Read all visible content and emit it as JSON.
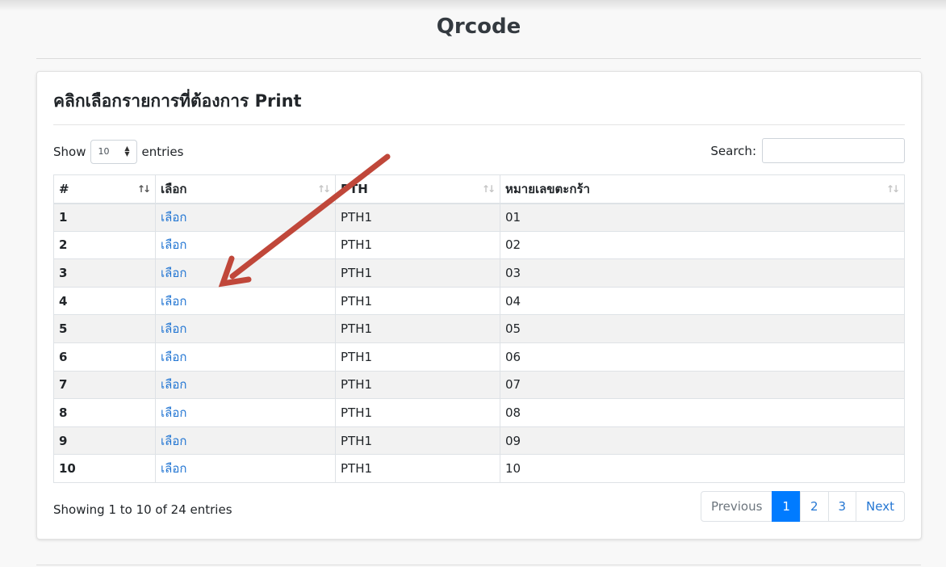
{
  "page": {
    "title": "Qrcode"
  },
  "card": {
    "heading_prefix": "คลิกเลือกรายการที่ต้องการ ",
    "heading_bold": "Print"
  },
  "length_menu": {
    "show_label": "Show",
    "selected": "10",
    "entries_label": "entries"
  },
  "search": {
    "label": "Search:",
    "value": "",
    "placeholder": ""
  },
  "table": {
    "headers": [
      "#",
      "เลือก",
      "PTH",
      "หมายเลขตะกร้า"
    ],
    "rows": [
      {
        "num": "1",
        "action": "เลือก",
        "pth": "PTH1",
        "basket": "01"
      },
      {
        "num": "2",
        "action": "เลือก",
        "pth": "PTH1",
        "basket": "02"
      },
      {
        "num": "3",
        "action": "เลือก",
        "pth": "PTH1",
        "basket": "03"
      },
      {
        "num": "4",
        "action": "เลือก",
        "pth": "PTH1",
        "basket": "04"
      },
      {
        "num": "5",
        "action": "เลือก",
        "pth": "PTH1",
        "basket": "05"
      },
      {
        "num": "6",
        "action": "เลือก",
        "pth": "PTH1",
        "basket": "06"
      },
      {
        "num": "7",
        "action": "เลือก",
        "pth": "PTH1",
        "basket": "07"
      },
      {
        "num": "8",
        "action": "เลือก",
        "pth": "PTH1",
        "basket": "08"
      },
      {
        "num": "9",
        "action": "เลือก",
        "pth": "PTH1",
        "basket": "09"
      },
      {
        "num": "10",
        "action": "เลือก",
        "pth": "PTH1",
        "basket": "10"
      }
    ]
  },
  "info": "Showing 1 to 10 of 24 entries",
  "pagination": {
    "previous": "Previous",
    "pages": [
      "1",
      "2",
      "3"
    ],
    "active_page": "1",
    "next": "Next"
  },
  "colors": {
    "link": "#2577d3",
    "active_page": "#007bff",
    "annotation_arrow": "#c0473a"
  },
  "icons": {
    "sort": "sort-both-icon",
    "length_select": "chevron-up-down-icon"
  }
}
